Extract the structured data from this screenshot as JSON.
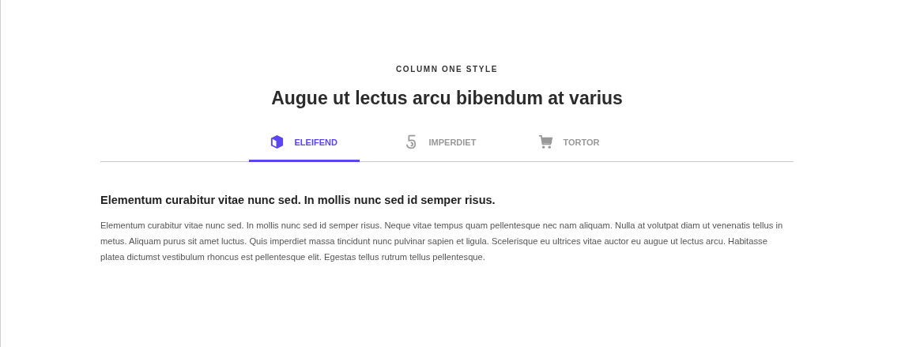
{
  "eyebrow": "COLUMN ONE STYLE",
  "heading": "Augue ut lectus arcu bibendum at varius",
  "tabs": [
    {
      "label": "ELEIFEND",
      "kind": "cube",
      "selected": true
    },
    {
      "label": "IMPERDIET",
      "kind": "five",
      "selected": false
    },
    {
      "label": "TORTOR",
      "kind": "cart",
      "selected": false
    }
  ],
  "panel": {
    "title": "Elementum curabitur vitae nunc sed. In mollis nunc sed id semper risus.",
    "body": "Elementum curabitur vitae nunc sed. In mollis nunc sed id semper risus. Neque vitae tempus quam pellentesque nec nam aliquam. Nulla at volutpat diam ut venenatis tellus in metus. Aliquam purus sit amet luctus. Quis imperdiet massa tincidunt nunc pulvinar sapien et ligula. Scelerisque eu ultrices vitae auctor eu augue ut lectus arcu. Habitasse platea dictumst vestibulum rhoncus est pellentesque elit. Egestas tellus rutrum tellus pellentesque."
  }
}
